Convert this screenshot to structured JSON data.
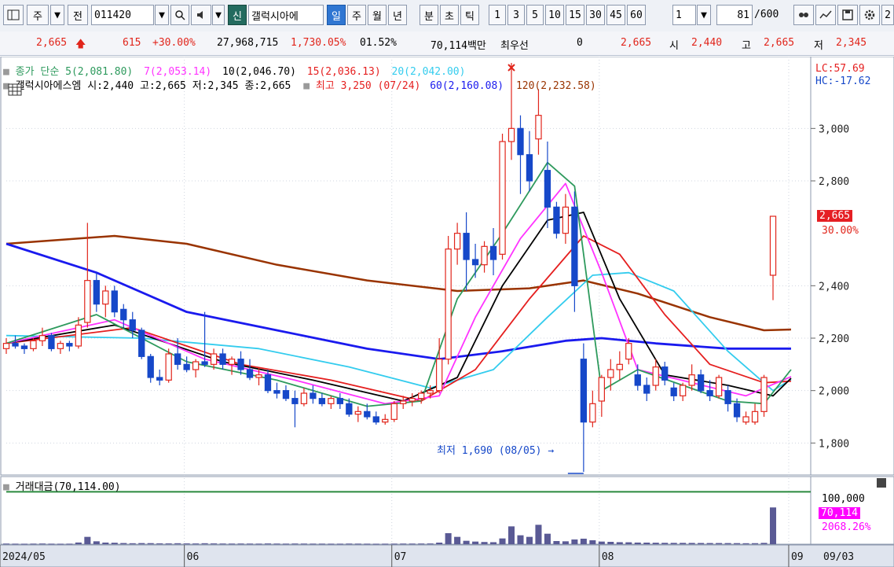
{
  "toolbar": {
    "period_label": "주",
    "prev_label": "전",
    "code_value": "011420",
    "new_label": "신",
    "stock_name": "갤럭시아에",
    "tabs": [
      "일",
      "주",
      "월",
      "년",
      "분",
      "초",
      "틱"
    ],
    "num_buttons": [
      "1",
      "3",
      "5",
      "10",
      "15",
      "30",
      "45",
      "60"
    ],
    "interval_value": "1",
    "count_value": "81",
    "count_total": "/600",
    "right_extra": "2"
  },
  "info": {
    "price": "2,665",
    "change": "615",
    "change_pct": "+30.00%",
    "volume": "27,968,715",
    "volume_pct": "1,730.05%",
    "turnover": "01.52%",
    "amount": "70,114백만",
    "priority_label": "최우선",
    "priority_value": "0",
    "price2": "2,665",
    "open_label": "시",
    "open": "2,440",
    "high_label": "고",
    "high": "2,665",
    "low_label": "저",
    "low": "2,345"
  },
  "legend": {
    "ma_header": "종가 단순",
    "ma5": "5(2,081.80)",
    "ma7": "7(2,053.14)",
    "ma10": "10(2,046.70)",
    "ma15": "15(2,036.13)",
    "ma20": "20(2,042.00)",
    "candle": "갤럭시아에스엠 시:2,440 고:2,665 저:2,345 종:2,665",
    "high_marker": "최고 3,250 (07/24)",
    "ma60": "60(2,160.08)",
    "ma120": "120(2,232.58)",
    "lc": "LC:57.69",
    "hc": "HC:-17.62"
  },
  "annotations": {
    "low_marker": "최저 1,690 (08/05)"
  },
  "price_box": {
    "value": "2,665",
    "pct": "30.00%"
  },
  "volume": {
    "title": "거래대금(70,114.00)",
    "level": "100,000",
    "box_value": "70,114",
    "box_pct": "2068.26%"
  },
  "colors": {
    "up": "#e1251b",
    "down": "#1648c9",
    "ma5": "#2e9a5d",
    "ma7": "#ff33ff",
    "ma10": "#000000",
    "ma15": "#e51f1f",
    "ma20": "#33ccee",
    "ma60": "#1a1aee",
    "ma120": "#993300",
    "volume": "#5a5a95"
  },
  "chart_data": {
    "type": "candlestick",
    "y_range": [
      1650,
      3300
    ],
    "y_ticks": [
      "3,000",
      "2,800",
      "2,400",
      "2,200",
      "2,000",
      "1,800"
    ],
    "x_labels": [
      "2024/05",
      "06",
      "07",
      "08",
      "09",
      "09/03"
    ],
    "candles": [
      [
        2160,
        2200,
        2140,
        2180
      ],
      [
        2180,
        2210,
        2160,
        2170
      ],
      [
        2170,
        2180,
        2140,
        2160
      ],
      [
        2160,
        2200,
        2150,
        2190
      ],
      [
        2190,
        2240,
        2170,
        2210
      ],
      [
        2210,
        2220,
        2150,
        2160
      ],
      [
        2160,
        2190,
        2140,
        2180
      ],
      [
        2180,
        2190,
        2150,
        2170
      ],
      [
        2170,
        2280,
        2160,
        2250
      ],
      [
        2260,
        2640,
        2240,
        2420
      ],
      [
        2420,
        2450,
        2300,
        2330
      ],
      [
        2330,
        2400,
        2280,
        2380
      ],
      [
        2380,
        2400,
        2280,
        2300
      ],
      [
        2310,
        2330,
        2240,
        2270
      ],
      [
        2270,
        2300,
        2200,
        2230
      ],
      [
        2230,
        2240,
        2120,
        2130
      ],
      [
        2130,
        2140,
        2030,
        2050
      ],
      [
        2050,
        2080,
        2020,
        2040
      ],
      [
        2040,
        2160,
        2030,
        2140
      ],
      [
        2140,
        2200,
        2080,
        2100
      ],
      [
        2100,
        2130,
        2070,
        2080
      ],
      [
        2080,
        2120,
        2050,
        2110
      ],
      [
        2110,
        2300,
        2090,
        2100
      ],
      [
        2100,
        2160,
        2080,
        2140
      ],
      [
        2140,
        2160,
        2080,
        2100
      ],
      [
        2100,
        2130,
        2060,
        2120
      ],
      [
        2120,
        2150,
        2060,
        2080
      ],
      [
        2080,
        2120,
        2040,
        2050
      ],
      [
        2050,
        2090,
        2020,
        2060
      ],
      [
        2060,
        2080,
        1990,
        2000
      ],
      [
        2000,
        2030,
        1970,
        1990
      ],
      [
        2000,
        2020,
        1960,
        1970
      ],
      [
        1970,
        2000,
        1860,
        1950
      ],
      [
        1950,
        2010,
        1940,
        1990
      ],
      [
        1990,
        2020,
        1950,
        1970
      ],
      [
        1970,
        1990,
        1940,
        1950
      ],
      [
        1950,
        1980,
        1930,
        1970
      ],
      [
        1970,
        1990,
        1930,
        1950
      ],
      [
        1950,
        1970,
        1900,
        1910
      ],
      [
        1910,
        1940,
        1880,
        1920
      ],
      [
        1920,
        1950,
        1890,
        1900
      ],
      [
        1900,
        1920,
        1870,
        1880
      ],
      [
        1880,
        1910,
        1870,
        1890
      ],
      [
        1890,
        1960,
        1880,
        1950
      ],
      [
        1950,
        1980,
        1930,
        1960
      ],
      [
        1960,
        1990,
        1940,
        1970
      ],
      [
        1970,
        2000,
        1950,
        1990
      ],
      [
        1990,
        2020,
        1970,
        2000
      ],
      [
        2000,
        2200,
        1990,
        2120
      ],
      [
        2120,
        2590,
        2100,
        2540
      ],
      [
        2540,
        2640,
        2480,
        2600
      ],
      [
        2600,
        2680,
        2380,
        2500
      ],
      [
        2500,
        2560,
        2430,
        2480
      ],
      [
        2480,
        2570,
        2450,
        2550
      ],
      [
        2550,
        2620,
        2440,
        2500
      ],
      [
        2520,
        2980,
        2500,
        2950
      ],
      [
        2950,
        3250,
        2880,
        3000
      ],
      [
        3000,
        3050,
        2750,
        2900
      ],
      [
        2900,
        2990,
        2760,
        2800
      ],
      [
        2960,
        3150,
        2900,
        3050
      ],
      [
        2840,
        2950,
        2620,
        2700
      ],
      [
        2700,
        2720,
        2580,
        2600
      ],
      [
        2600,
        2750,
        2560,
        2700
      ],
      [
        2700,
        2760,
        2300,
        2400
      ],
      [
        2120,
        2180,
        1690,
        1880
      ],
      [
        1880,
        2000,
        1860,
        1950
      ],
      [
        1960,
        2060,
        1900,
        2050
      ],
      [
        2050,
        2120,
        2000,
        2080
      ],
      [
        2080,
        2150,
        2040,
        2100
      ],
      [
        2120,
        2200,
        2100,
        2180
      ],
      [
        2060,
        2100,
        2000,
        2020
      ],
      [
        2020,
        2050,
        1960,
        1990
      ],
      [
        2020,
        2120,
        2000,
        2090
      ],
      [
        2090,
        2110,
        2020,
        2040
      ],
      [
        2010,
        2030,
        1960,
        1980
      ],
      [
        1980,
        2030,
        1960,
        2020
      ],
      [
        2020,
        2100,
        2000,
        2060
      ],
      [
        2060,
        2080,
        1990,
        2000
      ],
      [
        2000,
        2040,
        1960,
        1980
      ],
      [
        1980,
        2060,
        1970,
        2050
      ],
      [
        2000,
        2020,
        1920,
        1950
      ],
      [
        1950,
        1970,
        1880,
        1900
      ],
      [
        1880,
        1920,
        1870,
        1900
      ],
      [
        1880,
        1950,
        1870,
        1920
      ],
      [
        1920,
        2060,
        1900,
        2050
      ],
      [
        2440,
        2665,
        2345,
        2665
      ]
    ],
    "ma_series": [
      {
        "name": "5",
        "values": [
          [
            0,
            2180
          ],
          [
            10,
            2290
          ],
          [
            20,
            2110
          ],
          [
            30,
            2040
          ],
          [
            40,
            1940
          ],
          [
            46,
            1960
          ],
          [
            50,
            2350
          ],
          [
            55,
            2600
          ],
          [
            60,
            2870
          ],
          [
            63,
            2780
          ],
          [
            66,
            2000
          ],
          [
            70,
            2080
          ],
          [
            75,
            2020
          ],
          [
            80,
            1960
          ],
          [
            84,
            1950
          ],
          [
            87,
            2080
          ]
        ]
      },
      {
        "name": "7",
        "values": [
          [
            0,
            2180
          ],
          [
            12,
            2270
          ],
          [
            22,
            2120
          ],
          [
            32,
            2040
          ],
          [
            42,
            1950
          ],
          [
            48,
            1980
          ],
          [
            52,
            2280
          ],
          [
            57,
            2580
          ],
          [
            62,
            2790
          ],
          [
            66,
            2450
          ],
          [
            70,
            2080
          ],
          [
            76,
            2030
          ],
          [
            82,
            1980
          ],
          [
            87,
            2053
          ]
        ]
      },
      {
        "name": "10",
        "values": [
          [
            0,
            2180
          ],
          [
            12,
            2250
          ],
          [
            24,
            2110
          ],
          [
            34,
            2040
          ],
          [
            44,
            1960
          ],
          [
            50,
            2050
          ],
          [
            55,
            2400
          ],
          [
            60,
            2650
          ],
          [
            64,
            2680
          ],
          [
            68,
            2350
          ],
          [
            73,
            2060
          ],
          [
            80,
            2020
          ],
          [
            85,
            1980
          ],
          [
            87,
            2047
          ]
        ]
      },
      {
        "name": "15",
        "values": [
          [
            0,
            2180
          ],
          [
            14,
            2240
          ],
          [
            26,
            2100
          ],
          [
            36,
            2040
          ],
          [
            46,
            1960
          ],
          [
            52,
            2080
          ],
          [
            58,
            2350
          ],
          [
            64,
            2590
          ],
          [
            68,
            2520
          ],
          [
            73,
            2290
          ],
          [
            78,
            2100
          ],
          [
            84,
            2030
          ],
          [
            87,
            2036
          ]
        ]
      },
      {
        "name": "20",
        "values": [
          [
            0,
            2210
          ],
          [
            15,
            2200
          ],
          [
            28,
            2160
          ],
          [
            38,
            2090
          ],
          [
            47,
            2010
          ],
          [
            54,
            2080
          ],
          [
            60,
            2280
          ],
          [
            65,
            2440
          ],
          [
            69,
            2450
          ],
          [
            74,
            2380
          ],
          [
            80,
            2150
          ],
          [
            85,
            2000
          ],
          [
            87,
            2042
          ]
        ]
      },
      {
        "name": "60",
        "values": [
          [
            0,
            2560
          ],
          [
            10,
            2450
          ],
          [
            20,
            2300
          ],
          [
            30,
            2230
          ],
          [
            40,
            2160
          ],
          [
            48,
            2120
          ],
          [
            55,
            2150
          ],
          [
            62,
            2190
          ],
          [
            66,
            2200
          ],
          [
            72,
            2180
          ],
          [
            80,
            2160
          ],
          [
            87,
            2160
          ]
        ]
      },
      {
        "name": "120",
        "values": [
          [
            0,
            2560
          ],
          [
            12,
            2590
          ],
          [
            20,
            2560
          ],
          [
            30,
            2480
          ],
          [
            40,
            2420
          ],
          [
            50,
            2380
          ],
          [
            58,
            2390
          ],
          [
            64,
            2420
          ],
          [
            70,
            2370
          ],
          [
            78,
            2280
          ],
          [
            84,
            2230
          ],
          [
            87,
            2233
          ]
        ]
      }
    ],
    "volume_range": [
      0,
      120000
    ],
    "volume_level": 100000,
    "volumes": [
      1200,
      1000,
      900,
      1100,
      1300,
      1000,
      900,
      1000,
      3200,
      14000,
      5500,
      3100,
      2800,
      2200,
      1800,
      2100,
      2000,
      1600,
      1500,
      1800,
      1500,
      1400,
      1800,
      1500,
      1300,
      1200,
      1300,
      1200,
      1100,
      1400,
      1200,
      1100,
      1300,
      1200,
      1100,
      1100,
      1000,
      1000,
      1200,
      1100,
      1000,
      900,
      1000,
      1100,
      1200,
      1200,
      1300,
      1400,
      3000,
      21000,
      14000,
      6500,
      5000,
      4200,
      3800,
      11000,
      34000,
      17000,
      14000,
      37000,
      20000,
      6000,
      5500,
      9000,
      10500,
      7500,
      5000,
      4500,
      3800,
      3600,
      3100,
      3000,
      2800,
      2600,
      2500,
      2500,
      2400,
      2300,
      2200,
      2200,
      2100,
      2000,
      1800,
      1900,
      2500,
      70114
    ]
  }
}
